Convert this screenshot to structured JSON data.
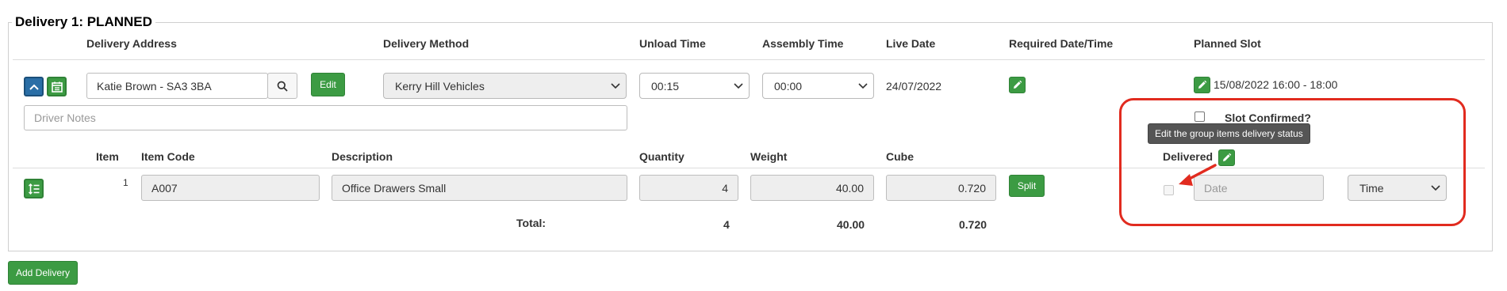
{
  "delivery": {
    "legend": "Delivery 1: PLANNED",
    "headers": {
      "address": "Delivery Address",
      "method": "Delivery Method",
      "unload": "Unload Time",
      "assembly": "Assembly Time",
      "live_date": "Live Date",
      "required": "Required Date/Time",
      "planned": "Planned Slot"
    },
    "address_value": "Katie Brown - SA3 3BA",
    "edit_label": "Edit",
    "method_value": "Kerry Hill Vehicles",
    "unload_value": "00:15",
    "assembly_value": "00:00",
    "live_date_value": "24/07/2022",
    "planned_slot_value": "15/08/2022 16:00 - 18:00",
    "driver_notes_placeholder": "Driver Notes",
    "slot_confirmed_label": "Slot Confirmed?",
    "tooltip": "Edit the group items delivery status"
  },
  "items": {
    "headers": {
      "item": "Item",
      "code": "Item Code",
      "description": "Description",
      "quantity": "Quantity",
      "weight": "Weight",
      "cube": "Cube",
      "delivered": "Delivered"
    },
    "rows": [
      {
        "item": "1",
        "code": "A007",
        "description": "Office Drawers Small",
        "quantity": "4",
        "weight": "40.00",
        "cube": "0.720",
        "split_label": "Split",
        "date_placeholder": "Date",
        "time_value": "Time"
      }
    ],
    "totals": {
      "label": "Total:",
      "quantity": "4",
      "weight": "40.00",
      "cube": "0.720"
    }
  },
  "add_delivery_label": "Add Delivery",
  "colors": {
    "accent_green": "#3c9b43",
    "collapse_blue": "#2a6ea6",
    "annotation_red": "#e12b1f"
  }
}
